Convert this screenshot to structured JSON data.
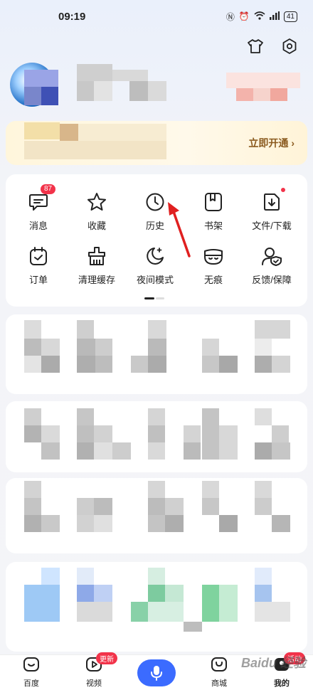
{
  "status_bar": {
    "time": "09:19",
    "battery": "41"
  },
  "top_icons": [
    "tshirt-icon",
    "settings-icon"
  ],
  "vip": {
    "cta": "立即开通"
  },
  "tools": [
    {
      "label": "消息",
      "icon": "message-icon",
      "badge": "87"
    },
    {
      "label": "收藏",
      "icon": "star-icon"
    },
    {
      "label": "历史",
      "icon": "clock-icon"
    },
    {
      "label": "书架",
      "icon": "bookshelf-icon"
    },
    {
      "label": "文件/下载",
      "icon": "download-file-icon",
      "dot": true
    },
    {
      "label": "订单",
      "icon": "order-icon"
    },
    {
      "label": "清理缓存",
      "icon": "clean-icon"
    },
    {
      "label": "夜间模式",
      "icon": "moon-icon"
    },
    {
      "label": "无痕",
      "icon": "mask-icon"
    },
    {
      "label": "反馈/保障",
      "icon": "shield-user-icon"
    }
  ],
  "tabbar": {
    "items": [
      {
        "label": "百度",
        "icon": "baidu-home-icon"
      },
      {
        "label": "视频",
        "icon": "video-icon",
        "badge": "更新"
      },
      {
        "label": "",
        "icon": "microphone-icon"
      },
      {
        "label": "商城",
        "icon": "shop-icon"
      },
      {
        "label": "我的",
        "icon": "profile-icon",
        "badge": "活动"
      }
    ]
  },
  "watermark": "Baidu 经验",
  "colors": {
    "accent": "#3b6bff",
    "badge": "#f2334a",
    "annotation_arrow": "#e02020"
  }
}
